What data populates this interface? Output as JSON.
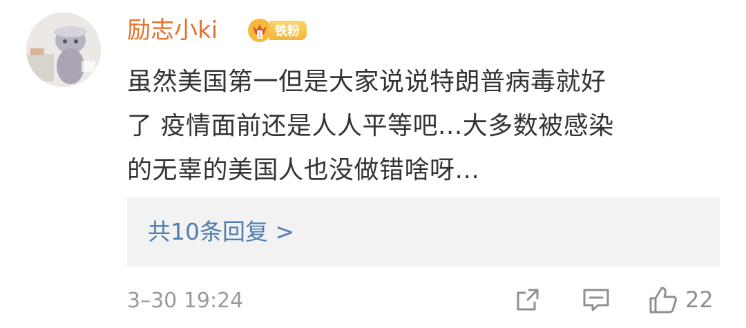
{
  "comment": {
    "user": {
      "name": "励志小ki",
      "badge_label": "铁粉"
    },
    "text_lines": [
      "虽然美国第一但是大家说说特朗普病毒就好",
      "了 疫情面前还是人人平等吧...大多数被感染",
      "的无辜的美国人也没做错啥呀..."
    ],
    "replies_label": "共10条回复 >",
    "timestamp": "3–30 19:24",
    "actions": {
      "like_count": "22",
      "icons": [
        "share-icon",
        "comment-icon",
        "like-icon"
      ]
    }
  },
  "colors": {
    "username": "#e3722c",
    "text": "#333333",
    "link": "#507daf",
    "muted": "#9a9a9a",
    "reply_bg": "#f2f2f2",
    "badge": "#f0b53a"
  }
}
